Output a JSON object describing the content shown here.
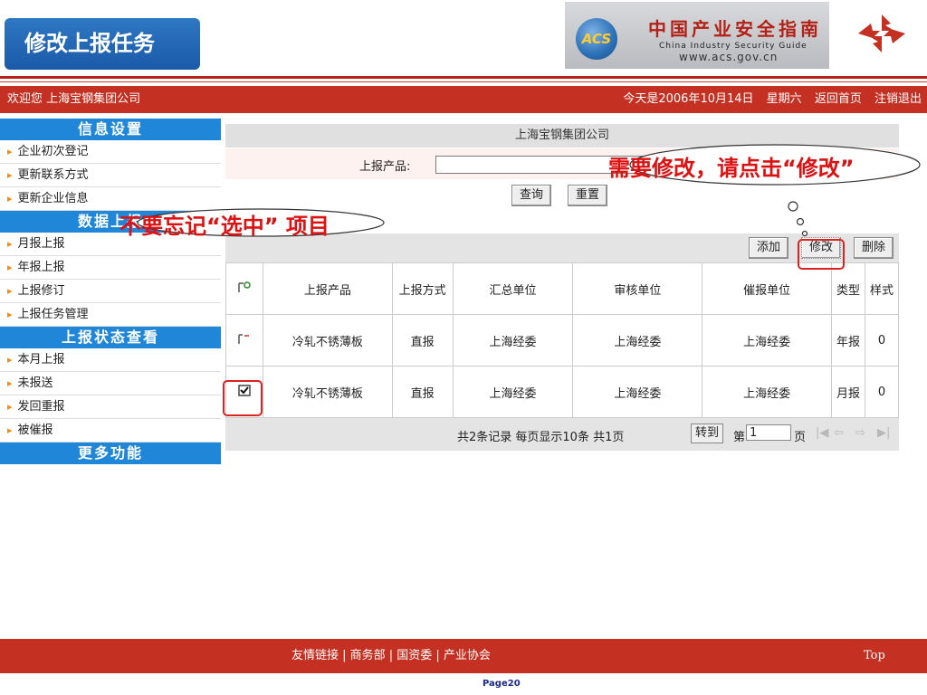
{
  "slide": {
    "title": "修改上报任务",
    "page": "Page20"
  },
  "logo": {
    "badge": "ACS",
    "cn": "中国产业安全指南",
    "en": "China  Industry  Security  Guide",
    "url": "www.acs.gov.cn"
  },
  "topbar": {
    "welcome": "欢迎您  上海宝钢集团公司",
    "date": "今天是2006年10月14日",
    "weekday": "星期六",
    "home": "返回首页",
    "logout": "注销退出"
  },
  "sidebar": {
    "sections": [
      {
        "title": "信息设置",
        "items": [
          "企业初次登记",
          "更新联系方式",
          "更新企业信息"
        ]
      },
      {
        "title": "数据上报",
        "items": [
          "月报上报",
          "年报上报",
          "上报修订",
          "上报任务管理"
        ]
      },
      {
        "title": "上报状态查看",
        "items": [
          "本月上报",
          "未报送",
          "发回重报",
          "被催报"
        ]
      },
      {
        "title": "更多功能",
        "items": []
      }
    ]
  },
  "main": {
    "company": "上海宝钢集团公司",
    "filter_label": "上报产品:",
    "query_button": "查询",
    "reset_button": "重置",
    "add_button": "添加",
    "edit_button": "修改",
    "delete_button": "删除",
    "columns": [
      "上报产品",
      "上报方式",
      "汇总单位",
      "审核单位",
      "催报单位",
      "类型",
      "样式"
    ],
    "rows": [
      {
        "product": "冷轧不锈薄板",
        "method": "直报",
        "summary": "上海经委",
        "audit": "上海经委",
        "urge": "上海经委",
        "type": "年报",
        "style": "0",
        "checked": false
      },
      {
        "product": "冷轧不锈薄板",
        "method": "直报",
        "summary": "上海经委",
        "audit": "上海经委",
        "urge": "上海经委",
        "type": "月报",
        "style": "0",
        "checked": true
      }
    ],
    "pager": {
      "summary": "共2条记录   每页显示10条   共1页",
      "goto_button": "转到",
      "page_prefix": "第",
      "page_value": "1",
      "page_suffix": "页"
    }
  },
  "callouts": {
    "edit_hint": "需要修改，请点击“修改”",
    "select_hint": "不要忘记“选中” 项目"
  },
  "footer": {
    "links": "友情链接 | 商务部 | 国资委 | 产业协会",
    "top": "Top"
  },
  "colors": {
    "brand_red": "#c43123",
    "sidebar_blue": "#1f86d8",
    "callout_red": "#dd1111"
  }
}
